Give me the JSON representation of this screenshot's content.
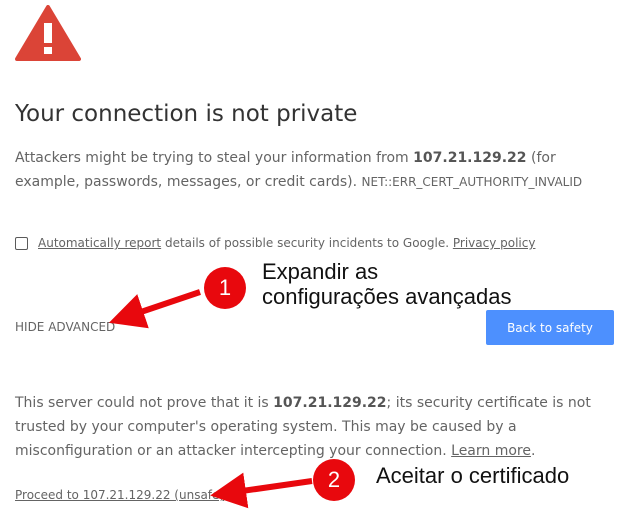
{
  "page": {
    "title": "Your connection is not private",
    "intro_before": "Attackers might be trying to steal your information from ",
    "host": "107.21.129.22",
    "intro_after": " (for example, passwords, messages, or credit cards). ",
    "error_code": "NET::ERR_CERT_AUTHORITY_INVALID"
  },
  "report": {
    "checked": false,
    "link_text": "Automatically report",
    "text": " details of possible security incidents to Google. ",
    "privacy_link": "Privacy policy"
  },
  "actions": {
    "hide_advanced": "HIDE ADVANCED",
    "back_to_safety": "Back to safety"
  },
  "advanced": {
    "text_before": "This server could not prove that it is ",
    "host": "107.21.129.22",
    "text_after": "; its security certificate is not trusted by your computer's operating system. This may be caused by a misconfiguration or an attacker intercepting your connection. ",
    "learn_more": "Learn more",
    "period": ".",
    "proceed_link": "Proceed to 107.21.129.22 (unsafe)"
  },
  "annotations": [
    {
      "number": "1",
      "line1": "Expandir as",
      "line2": "configurações avançadas"
    },
    {
      "number": "2",
      "text": "Aceitar o certificado"
    }
  ],
  "colors": {
    "warning_red": "#db4437",
    "button_blue": "#4d90fe",
    "annotation_red": "#e8080d"
  }
}
